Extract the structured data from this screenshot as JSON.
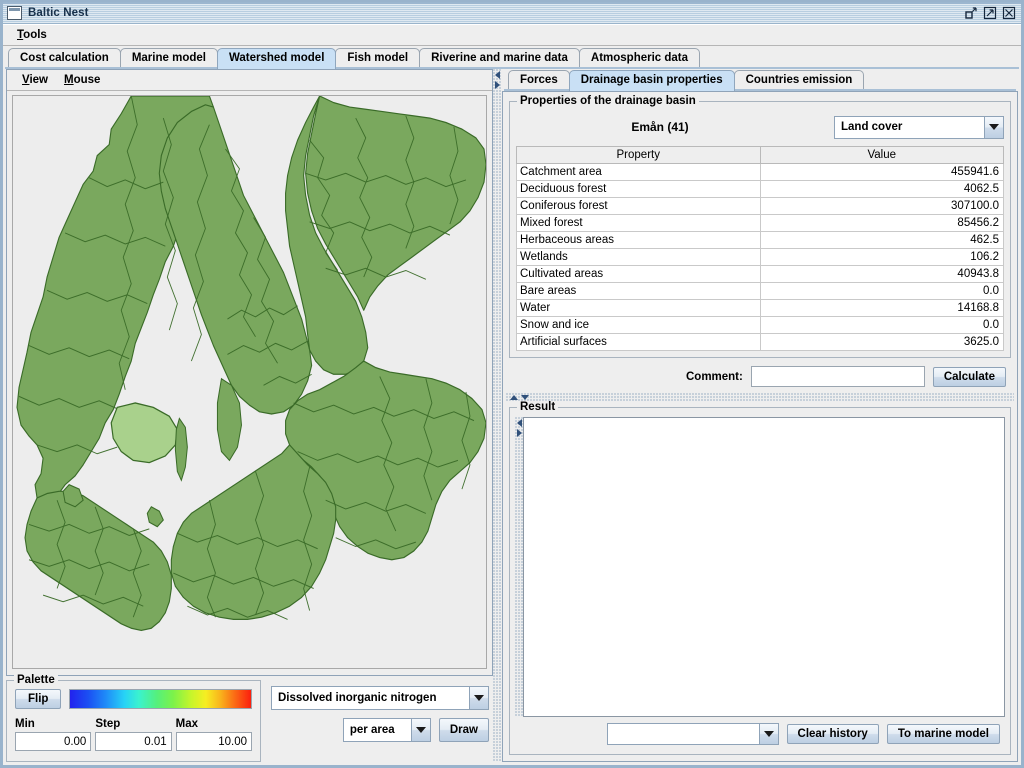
{
  "window": {
    "title": "Baltic Nest",
    "icon": "window-app-icon",
    "controls": [
      {
        "name": "restore-button",
        "glyph": "restore"
      },
      {
        "name": "maximize-button",
        "glyph": "maximize"
      },
      {
        "name": "close-button",
        "glyph": "close"
      }
    ]
  },
  "menubar": {
    "items": [
      {
        "label": "Tools",
        "mnemonic": "T"
      }
    ]
  },
  "main_tabs": {
    "selected": "Watershed model",
    "items": [
      {
        "label": "Cost calculation"
      },
      {
        "label": "Marine model"
      },
      {
        "label": "Watershed model"
      },
      {
        "label": "Fish model"
      },
      {
        "label": "Riverine and marine data"
      },
      {
        "label": "Atmospheric data"
      }
    ]
  },
  "map_panel": {
    "menus": [
      {
        "label": "View",
        "mnemonic": "V"
      },
      {
        "label": "Mouse",
        "mnemonic": "M"
      }
    ],
    "canvas_name": "baltic-drainage-basin-map",
    "colors": {
      "land": "#7aa85e",
      "land_highlight": "#a9d18c",
      "outline": "#3a6b28",
      "sea": "#ededed"
    }
  },
  "palette": {
    "title": "Palette",
    "flip_label": "Flip",
    "gradient_name": "rainbow-color-ramp",
    "fields": [
      {
        "label": "Min",
        "value": "0.00"
      },
      {
        "label": "Step",
        "value": "0.01"
      },
      {
        "label": "Max",
        "value": "10.00"
      }
    ]
  },
  "draw_controls": {
    "variable": "Dissolved inorganic nitrogen",
    "unit_mode": "per area",
    "draw_label": "Draw"
  },
  "sub_tabs": {
    "selected": "Drainage basin properties",
    "items": [
      {
        "label": "Forces"
      },
      {
        "label": "Drainage basin properties"
      },
      {
        "label": "Countries emission"
      }
    ]
  },
  "properties_panel": {
    "group_title": "Properties of the drainage basin",
    "basin_name": "Emån (41)",
    "category": "Land cover",
    "columns": [
      "Property",
      "Value"
    ],
    "rows": [
      {
        "property": "Catchment area",
        "value": "455941.6"
      },
      {
        "property": "Deciduous forest",
        "value": "4062.5"
      },
      {
        "property": "Coniferous forest",
        "value": "307100.0"
      },
      {
        "property": "Mixed forest",
        "value": "85456.2"
      },
      {
        "property": "Herbaceous areas",
        "value": "462.5"
      },
      {
        "property": "Wetlands",
        "value": "106.2"
      },
      {
        "property": "Cultivated areas",
        "value": "40943.8"
      },
      {
        "property": "Bare areas",
        "value": "0.0"
      },
      {
        "property": "Water",
        "value": "14168.8"
      },
      {
        "property": "Snow and ice",
        "value": "0.0"
      },
      {
        "property": "Artificial surfaces",
        "value": "3625.0"
      }
    ]
  },
  "comment_row": {
    "label": "Comment:",
    "value": "",
    "placeholder": "",
    "calculate_label": "Calculate"
  },
  "result_panel": {
    "title": "Result",
    "content": "",
    "history_value": "",
    "clear_history_label": "Clear history",
    "to_marine_model_label": "To marine model"
  }
}
